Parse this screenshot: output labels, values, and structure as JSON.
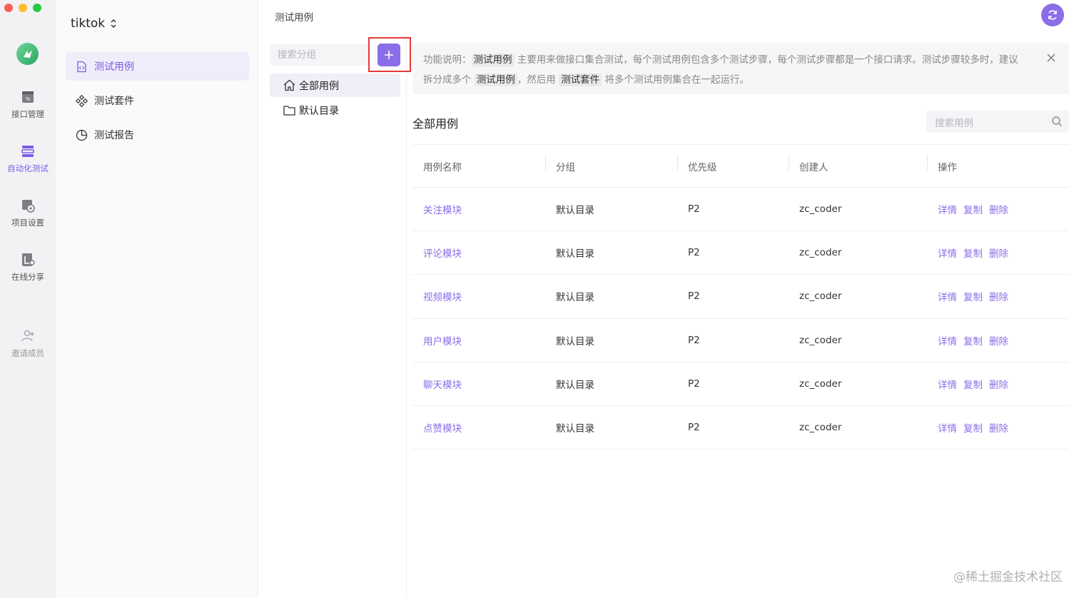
{
  "window": {
    "traffic_lights": [
      "close",
      "minimize",
      "zoom"
    ]
  },
  "rail": {
    "items": [
      {
        "label": "接口管理",
        "icon": "api-icon"
      },
      {
        "label": "自动化测试",
        "icon": "automation-icon"
      },
      {
        "label": "项目设置",
        "icon": "settings-icon"
      },
      {
        "label": "在线分享",
        "icon": "share-icon"
      },
      {
        "label": "邀请成员",
        "icon": "invite-icon"
      }
    ],
    "active_color": "#7b5ce6"
  },
  "sidebar": {
    "project_name": "tiktok",
    "items": [
      {
        "label": "测试用例",
        "icon": "file-code-icon"
      },
      {
        "label": "测试套件",
        "icon": "suite-icon"
      },
      {
        "label": "测试报告",
        "icon": "pie-chart-icon"
      }
    ]
  },
  "topbar": {
    "title": "测试用例"
  },
  "groups": {
    "search_placeholder": "搜索分组",
    "items": [
      {
        "label": "全部用例",
        "icon": "home-icon"
      },
      {
        "label": "默认目录",
        "icon": "folder-icon"
      }
    ]
  },
  "notice": {
    "prefix": "功能说明：",
    "hl1": "测试用例",
    "text1": "主要用来做接口集合测试，每个测试用例包含多个测试步骤，每个测试步骤都是一个接口请求。测试步骤较多时，建议拆分成多个",
    "hl2": "测试用例",
    "text2": "，然后用",
    "hl3": "测试套件",
    "text3": "将多个测试用例集合在一起运行。"
  },
  "main": {
    "section_title": "全部用例",
    "search_placeholder": "搜索用例",
    "columns": [
      "用例名称",
      "分组",
      "优先级",
      "创建人",
      "操作"
    ],
    "rows": [
      {
        "name": "关注模块",
        "group": "默认目录",
        "priority": "P2",
        "creator": "zc_coder"
      },
      {
        "name": "评论模块",
        "group": "默认目录",
        "priority": "P2",
        "creator": "zc_coder"
      },
      {
        "name": "视频模块",
        "group": "默认目录",
        "priority": "P2",
        "creator": "zc_coder"
      },
      {
        "name": "用户模块",
        "group": "默认目录",
        "priority": "P2",
        "creator": "zc_coder"
      },
      {
        "name": "聊天模块",
        "group": "默认目录",
        "priority": "P2",
        "creator": "zc_coder"
      },
      {
        "name": "点赞模块",
        "group": "默认目录",
        "priority": "P2",
        "creator": "zc_coder"
      }
    ],
    "actions": [
      "详情",
      "复制",
      "删除"
    ]
  },
  "watermark": "@稀土掘金技术社区",
  "colors": {
    "accent": "#8b6de8",
    "highlight_border": "#e53935"
  }
}
